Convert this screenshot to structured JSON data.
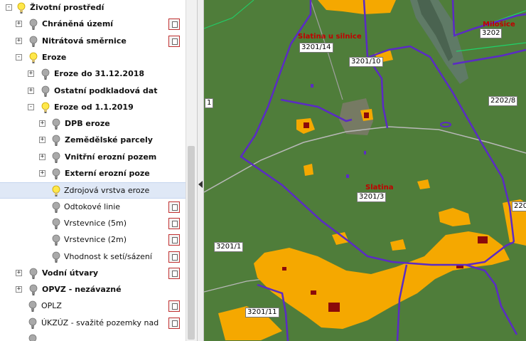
{
  "layer_tree": {
    "rows": [
      {
        "label": "Životní prostředí",
        "level": 0,
        "expander": "-",
        "bulb": "on",
        "bold": true,
        "legend": false,
        "selected": false
      },
      {
        "label": "Chráněná území",
        "level": 1,
        "expander": "+",
        "bulb": "off",
        "bold": true,
        "legend": true,
        "selected": false
      },
      {
        "label": "Nitrátová směrnice",
        "level": 1,
        "expander": "+",
        "bulb": "off",
        "bold": true,
        "legend": true,
        "selected": false
      },
      {
        "label": "Eroze",
        "level": 1,
        "expander": "-",
        "bulb": "on",
        "bold": true,
        "legend": false,
        "selected": false
      },
      {
        "label": "Eroze do 31.12.2018",
        "level": 2,
        "expander": "+",
        "bulb": "off",
        "bold": true,
        "legend": false,
        "selected": false
      },
      {
        "label": "Ostatní podkladová dat",
        "level": 2,
        "expander": "+",
        "bulb": "off",
        "bold": true,
        "legend": false,
        "selected": false
      },
      {
        "label": "Eroze od 1.1.2019",
        "level": 2,
        "expander": "-",
        "bulb": "on",
        "bold": true,
        "legend": false,
        "selected": false
      },
      {
        "label": "DPB eroze",
        "level": 3,
        "expander": "+",
        "bulb": "off",
        "bold": true,
        "legend": false,
        "selected": false
      },
      {
        "label": "Zemědělské parcely",
        "level": 3,
        "expander": "+",
        "bulb": "off",
        "bold": true,
        "legend": false,
        "selected": false
      },
      {
        "label": "Vnitřní erozní pozem",
        "level": 3,
        "expander": "+",
        "bulb": "off",
        "bold": true,
        "legend": false,
        "selected": false
      },
      {
        "label": "Externí erozní poze",
        "level": 3,
        "expander": "+",
        "bulb": "off",
        "bold": true,
        "legend": false,
        "selected": false
      },
      {
        "label": "Zdrojová vrstva eroze",
        "level": 4,
        "expander": "",
        "bulb": "on",
        "bold": false,
        "legend": false,
        "selected": true
      },
      {
        "label": "Odtokové linie",
        "level": 4,
        "expander": "",
        "bulb": "off",
        "bold": false,
        "legend": true,
        "selected": false
      },
      {
        "label": "Vrstevnice (5m)",
        "level": 4,
        "expander": "",
        "bulb": "off",
        "bold": false,
        "legend": true,
        "selected": false
      },
      {
        "label": "Vrstevnice (2m)",
        "level": 4,
        "expander": "",
        "bulb": "off",
        "bold": false,
        "legend": true,
        "selected": false
      },
      {
        "label": "Vhodnost k setí/sázení",
        "level": 4,
        "expander": "",
        "bulb": "off",
        "bold": false,
        "legend": true,
        "selected": false
      },
      {
        "label": "Vodní útvary",
        "level": 1,
        "expander": "+",
        "bulb": "off",
        "bold": true,
        "legend": true,
        "selected": false
      },
      {
        "label": "OPVZ - nezávazné",
        "level": 1,
        "expander": "+",
        "bulb": "off",
        "bold": true,
        "legend": false,
        "selected": false
      },
      {
        "label": "OPLZ",
        "level": 2,
        "expander": "",
        "bulb": "off",
        "bold": false,
        "legend": true,
        "selected": false
      },
      {
        "label": "ÚKZÚZ - svažité pozemky nad",
        "level": 2,
        "expander": "",
        "bulb": "off",
        "bold": false,
        "legend": true,
        "selected": false
      },
      {
        "label": "",
        "level": 2,
        "expander": "",
        "bulb": "off",
        "bold": false,
        "legend": false,
        "selected": false
      }
    ]
  },
  "map": {
    "place_labels": {
      "slatina_u_silnice": "Slatina u silnice",
      "slatina": "Slatina",
      "milosice": "Milošice"
    },
    "parcel_labels": {
      "p3201_14": "3201/14",
      "p3201_10": "3201/10",
      "p3202": "3202",
      "p2202_8": "2202/8",
      "p3201_3": "3201/3",
      "p3201_1": "3201/1",
      "p3201_11": "3201/11",
      "p220": "220",
      "p1": "1"
    },
    "colors": {
      "field": "#4f7d3a",
      "erosion_high": "#f5a800",
      "erosion_extreme": "#8b0a0a",
      "parcel_border": "#5b2bc4",
      "road": "#b8b8b8",
      "place_label": "#c00000"
    }
  }
}
